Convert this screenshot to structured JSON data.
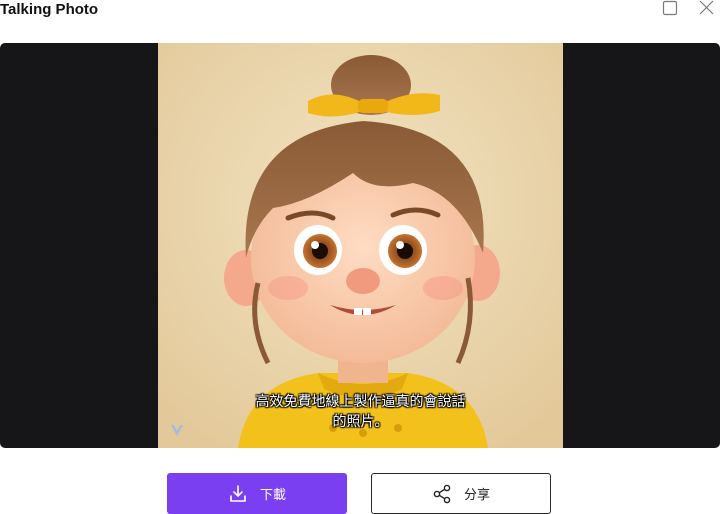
{
  "window": {
    "title": "Talking Photo"
  },
  "video": {
    "subtitle_line1": "高效免費地線上製作逼真的會說話",
    "subtitle_line2": "的照片。",
    "colors": {
      "background": "#161618",
      "photo_bg": "#ead7ad"
    }
  },
  "actions": {
    "download_label": "下載",
    "share_label": "分享",
    "download_color": "#7b3ff2"
  },
  "icons": {
    "maximize": "square-icon",
    "close": "close-icon",
    "download": "download-icon",
    "share": "share-icon",
    "watermark": "logo-watermark-icon"
  }
}
